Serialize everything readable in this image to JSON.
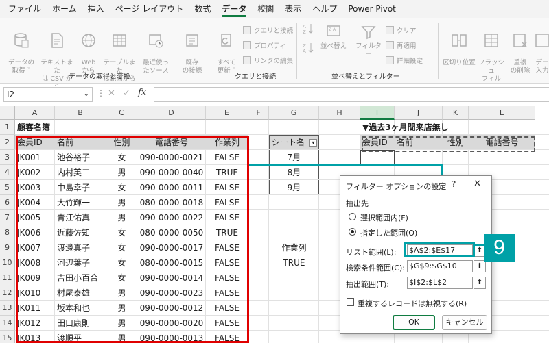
{
  "menu": {
    "items": [
      "ファイル",
      "ホーム",
      "挿入",
      "ページ レイアウト",
      "数式",
      "データ",
      "校閲",
      "表示",
      "ヘルプ",
      "Power Pivot"
    ],
    "active_index": 5
  },
  "ribbon": {
    "get_data": "データの\n取得 ˅",
    "text_csv": "テキストまた\nは CSV から",
    "web": "Web\nから",
    "table_range": "テーブルまた\nは範囲から",
    "recent_sources": "最近使っ\nたソース",
    "existing_conn": "既存\nの接続",
    "group1_label": "データの取得と変換",
    "refresh_all": "すべて\n更新 ˅",
    "queries_conn": "クエリと接続",
    "properties": "プロパティ",
    "edit_links": "リンクの編集",
    "group2_label": "クエリと接続",
    "sort_label": "並べ替え",
    "filter_label": "フィルター",
    "clear": "クリア",
    "reapply": "再適用",
    "advanced": "詳細設定",
    "group3_label": "並べ替えとフィルター",
    "text_to_cols": "区切り位置",
    "flash_fill": "フラッシュ\nフィル",
    "remove_dup": "重複\nの削除",
    "data_validation": "デー\n入力"
  },
  "formula_bar": {
    "name_box": "I2",
    "fx": "fx",
    "content": ""
  },
  "columns": [
    "A",
    "B",
    "C",
    "D",
    "E",
    "F",
    "G",
    "H",
    "I",
    "J",
    "K",
    "L"
  ],
  "selected_column": "I",
  "rows": [
    "1",
    "2",
    "3",
    "4",
    "5",
    "6",
    "7",
    "8",
    "9",
    "10",
    "11",
    "12",
    "13",
    "14",
    "15"
  ],
  "sheet": {
    "title": "顧客名簿",
    "headers": [
      "会員ID",
      "名前",
      "性別",
      "電話番号",
      "作業列"
    ],
    "records": [
      [
        "JK001",
        "池谷裕子",
        "女",
        "090-0000-0021",
        "FALSE"
      ],
      [
        "JK002",
        "内村英二",
        "男",
        "090-0000-0040",
        "TRUE"
      ],
      [
        "JK003",
        "中島幸子",
        "女",
        "090-0000-0011",
        "FALSE"
      ],
      [
        "JK004",
        "大竹輝一",
        "男",
        "080-0000-0018",
        "FALSE"
      ],
      [
        "JK005",
        "青江佑真",
        "男",
        "090-0000-0022",
        "FALSE"
      ],
      [
        "JK006",
        "近藤佐知",
        "女",
        "080-0000-0050",
        "TRUE"
      ],
      [
        "JK007",
        "渡邊真子",
        "女",
        "090-0000-0017",
        "FALSE"
      ],
      [
        "JK008",
        "河辺葉子",
        "女",
        "080-0000-0015",
        "FALSE"
      ],
      [
        "JK009",
        "吉田小百合",
        "女",
        "090-0000-0014",
        "FALSE"
      ],
      [
        "JK010",
        "村尾泰雄",
        "男",
        "090-0000-0023",
        "FALSE"
      ],
      [
        "JK011",
        "坂本和也",
        "男",
        "090-0000-0012",
        "FALSE"
      ],
      [
        "JK012",
        "田口康則",
        "男",
        "090-0000-0020",
        "FALSE"
      ],
      [
        "JK013",
        "渡順平",
        "男",
        "090-0000-0013",
        "FALSE"
      ]
    ],
    "sheet_name_header": "シート名",
    "sheet_names": [
      "7月",
      "8月",
      "9月"
    ],
    "criteria_header": "作業列",
    "criteria_value": "TRUE",
    "output_title": "▼過去3ヶ月間来店無し",
    "output_headers": [
      "会員ID",
      "名前",
      "性別",
      "電話番号"
    ]
  },
  "dialog": {
    "title": "フィルター オプションの設定",
    "help": "?",
    "close": "✕",
    "section": "抽出先",
    "radio1": "選択範囲内(F)",
    "radio2": "指定した範囲(O)",
    "list_range_label": "リスト範囲(L):",
    "list_range_value": "$A$2:$E$17",
    "criteria_range_label": "検索条件範囲(C):",
    "criteria_range_value": "$G$9:$G$10",
    "extract_range_label": "抽出範囲(T):",
    "extract_range_value": "$I$2:$L$2",
    "unique_label": "重複するレコードは無視する(R)",
    "ok": "OK",
    "cancel": "キャンセル",
    "pick_icon": "range-picker-icon"
  },
  "annotation": {
    "step": "9",
    "accent": "#00a1a7",
    "highlight": "#e00000"
  }
}
